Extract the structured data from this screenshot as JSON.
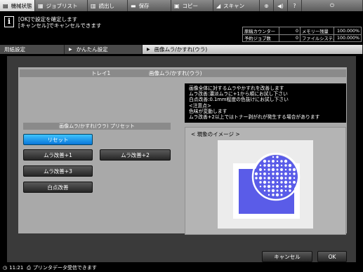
{
  "tabs": {
    "machine_status": "機械状態",
    "job_list": "ジョブリスト",
    "retrieve": "読出し",
    "save": "保存",
    "copy": "コピー",
    "scan": "スキャン"
  },
  "message": {
    "line1": "[OK]で設定を確定します",
    "line2": "[キャンセル]でキャンセルできます"
  },
  "status": {
    "orig_counter_label": "原稿カウンター",
    "orig_counter_value": "0",
    "memory_label": "メモリー残量",
    "memory_value": "100.000%",
    "reserve_label": "予約ジョブ数",
    "reserve_value": "0",
    "fs_label": "ファイルシステム残量",
    "fs_value": "100.000%"
  },
  "breadcrumb": {
    "item1": "用紙設定",
    "item2": "かんたん設定",
    "item3": "画像ムラ/かすれ(ウラ)"
  },
  "header": {
    "tray": "トレイ1",
    "title": "画像ムラ/かすれ(ウラ)"
  },
  "preset": {
    "title": "画像ムラ/かすれ(ウラ) プリセット",
    "reset": "リセット",
    "mura1": "ムラ改善+1",
    "mura2": "ムラ改善+2",
    "mura3": "ムラ改善+3",
    "white": "白点改善"
  },
  "description": {
    "l1": "画像全体に対するムラやかすれを改善します",
    "l2": "ムラ改善:濃淡ムラに+1から順にお試し下さい",
    "l3": "白点改善:0.1mm程度の色抜けにお試し下さい",
    "l4": "<注意点>",
    "l5": "色味が変動します",
    "l6": "ムラ改善+2以上ではトナー剥がれが発生する場合があります"
  },
  "image_area": {
    "label": "< 現象のイメージ >"
  },
  "buttons": {
    "cancel": "キャンセル",
    "ok": "OK"
  },
  "statusbar": {
    "time": "11:21",
    "message": "プリンタデータ受信できます"
  },
  "colors": {
    "accent_blue": "#0a76d8",
    "sample_blue": "#5a5ce8"
  }
}
